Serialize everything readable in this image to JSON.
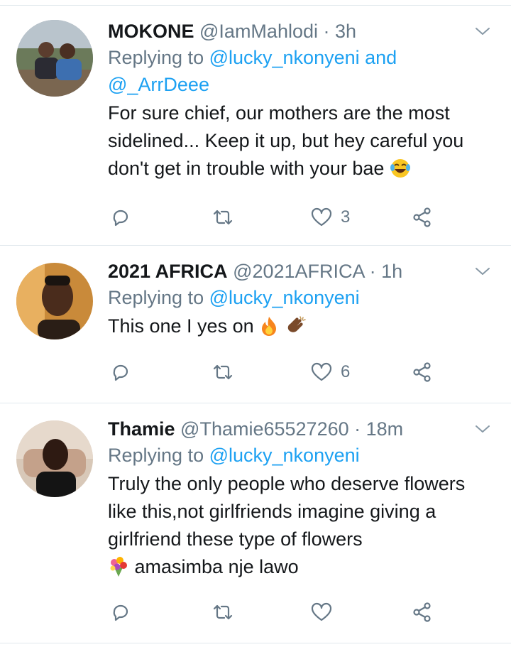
{
  "colors": {
    "accent": "#1da1f2",
    "muted": "#657786",
    "text": "#14171a",
    "divider": "#e1e8ed"
  },
  "tweets": [
    {
      "name": "MOKONE",
      "handle": "@IamMahlodi",
      "sep": " · ",
      "time": "3h",
      "replying_prefix": "Replying to ",
      "mention1": "@lucky_nkonyeni",
      "joiner": " and",
      "mention2": "@_ArrDeee",
      "text": "For sure chief, our mothers are the most sidelined... Keep it up, but hey careful you don't get in trouble with your bae",
      "emoji": "face-with-tears-of-joy",
      "likes": "3"
    },
    {
      "name": "2021 AFRICA",
      "handle": "@2021AFRICA",
      "sep": " · ",
      "time": "1h",
      "replying_prefix": "Replying to ",
      "mention1": "@lucky_nkonyeni",
      "text": "This one I yes on",
      "emoji": "fire, clapping-hands",
      "likes": "6"
    },
    {
      "name": "Thamie",
      "handle": "@Thamie65527260",
      "sep": " · ",
      "time": "18m",
      "replying_prefix": "Replying to ",
      "mention1": "@lucky_nkonyeni",
      "text1": "Truly the only people who deserve flowers like this,not girlfriends imagine giving a girlfriend these type of flowers",
      "text2": "amasimba nje lawo",
      "emoji": "bouquet",
      "likes": ""
    }
  ]
}
